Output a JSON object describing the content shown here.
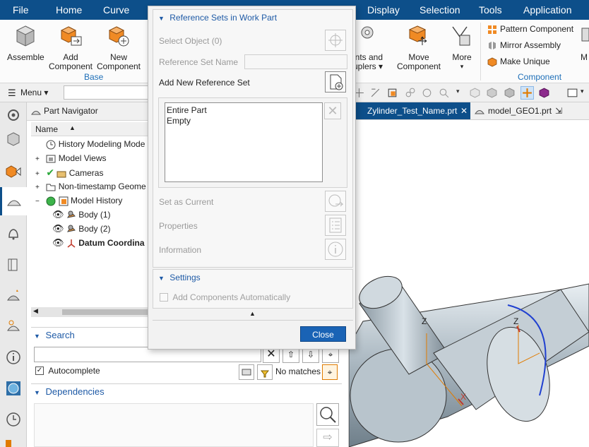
{
  "menubar": {
    "items": [
      "File",
      "Home",
      "Curve",
      "Display",
      "Selection",
      "Tools",
      "Application"
    ]
  },
  "ribbon": {
    "assemble": "Assemble",
    "add_component": [
      "Add",
      "Component"
    ],
    "new_component": [
      "New",
      "Component"
    ],
    "base_label": "Base",
    "joints_couplers": [
      "ints and",
      "uplers"
    ],
    "move_component": [
      "Move",
      "Component"
    ],
    "more": "More",
    "pattern_component": "Pattern Component",
    "mirror_assembly": "Mirror Assembly",
    "make_unique": "Make Unique",
    "component_label": "Component",
    "truncated_m": "M"
  },
  "toolbar2": {
    "menu_label": "Menu"
  },
  "navigator": {
    "title": "Part Navigator",
    "column_name": "Name",
    "items": [
      "History Modeling Mode",
      "Model Views",
      "Cameras",
      "Non-timestamp Geome",
      "Model History",
      "Body (1)",
      "Body (2)",
      "Datum Coordina"
    ],
    "search_label": "Search",
    "search_value": "",
    "autocomplete_label": "Autocomplete",
    "no_matches": "No matches",
    "dependencies_label": "Dependencies"
  },
  "tabs": {
    "active": "Zylinder_Test_Name.prt",
    "other": "model_GEO1.prt"
  },
  "dialog": {
    "section_title": "Reference Sets in Work Part",
    "select_object": "Select Object (0)",
    "reference_set_name": "Reference Set Name",
    "reference_set_name_value": "",
    "add_new_reference_set": "Add New Reference Set",
    "list_items": [
      "Entire Part",
      "Empty"
    ],
    "set_as_current": "Set as Current",
    "properties": "Properties",
    "information": "Information",
    "settings_title": "Settings",
    "add_components_auto": "Add Components Automatically",
    "close_label": "Close"
  },
  "colors": {
    "menubar": "#0d4f8a",
    "accent": "#1e6fb8",
    "tab_active": "#0d4f8a",
    "close_button": "#1a63b5"
  }
}
